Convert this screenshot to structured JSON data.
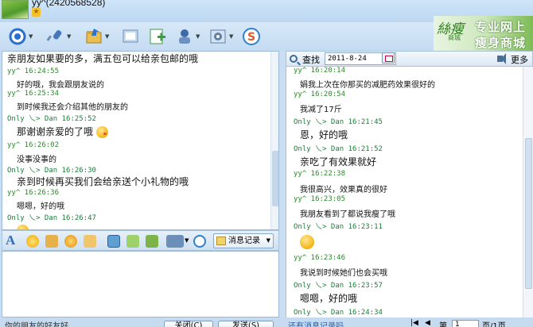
{
  "window": {
    "title": "yy^(2420568528)"
  },
  "toolbar": {
    "buttons": [
      {
        "name": "video-call-icon",
        "color": "#2b6fcf"
      },
      {
        "name": "voice-mic-icon",
        "color": "#4677b8"
      },
      {
        "name": "send-file-icon",
        "color": "#d2a23a"
      },
      {
        "name": "screenshot-icon",
        "color": "#6b8fb8"
      },
      {
        "name": "add-app-icon",
        "color": "#3c9b3c"
      },
      {
        "name": "remote-assist-icon",
        "color": "#3f6aa8"
      },
      {
        "name": "settings-icon",
        "color": "#5f7fa6"
      },
      {
        "name": "s-app-icon",
        "color": "#e2572b"
      }
    ]
  },
  "banner": {
    "logo": "絲瘦",
    "logo_sub": "商城",
    "line1": "专业网上",
    "line2": "瘦身商城"
  },
  "left_chat": {
    "messages": [
      {
        "kind": "text-big",
        "text": "亲朋友如果要的多，满五包可以给亲包邮的哦"
      },
      {
        "kind": "header",
        "text": "yy^  16:24:55"
      },
      {
        "kind": "text-sm",
        "text": "好的哦，我会跟朋友说的"
      },
      {
        "kind": "header",
        "text": "yy^  16:25:34"
      },
      {
        "kind": "text-sm",
        "text": "到时候我还会介绍其他的朋友的"
      },
      {
        "kind": "header-self",
        "text": "Only 乀> Dan  16:25:52"
      },
      {
        "kind": "text-big-emoji",
        "text": "那谢谢亲爱的了哦"
      },
      {
        "kind": "header",
        "text": "yy^  16:26:02"
      },
      {
        "kind": "text-sm",
        "text": "没事没事的"
      },
      {
        "kind": "header-self",
        "text": "Only 乀> Dan  16:26:30"
      },
      {
        "kind": "text-big",
        "text": "亲到时候再买我们会给亲送个小礼物的哦"
      },
      {
        "kind": "header",
        "text": "yy^  16:26:36"
      },
      {
        "kind": "text-sm",
        "text": "嗯嗯，好的哦"
      },
      {
        "kind": "header-self",
        "text": "Only 乀> Dan  16:26:47"
      }
    ]
  },
  "format_bar": {
    "font_label": "A",
    "icons": [
      "emoji-icon",
      "gift-icon",
      "shake-icon",
      "scribble-icon",
      "image-icon",
      "music-icon",
      "magic-face-icon",
      "screenshot-icon",
      "s-app-icon"
    ],
    "message_log_label": "消息记录"
  },
  "bottom": {
    "hint": "你的朋友的好友好",
    "close_label": "关闭(C)",
    "send_label": "发送(S)"
  },
  "right_head": {
    "find_label": "查找",
    "date_value": "2011-8-24",
    "more_label": "更多"
  },
  "right_chat": {
    "messages": [
      {
        "kind": "header",
        "text": "yy^  16:20:14"
      },
      {
        "kind": "text-sm",
        "text": "娟我上次在你那买的减肥药效果很好的"
      },
      {
        "kind": "header",
        "text": "yy^  16:20:54"
      },
      {
        "kind": "text-sm",
        "text": "我减了17斤"
      },
      {
        "kind": "header-self",
        "text": "Only 乀> Dan  16:21:45"
      },
      {
        "kind": "text-big",
        "text": "恩，好的哦"
      },
      {
        "kind": "header-self",
        "text": "Only 乀> Dan  16:21:52"
      },
      {
        "kind": "text-big",
        "text": "亲吃了有效果就好"
      },
      {
        "kind": "header",
        "text": "yy^  16:22:38"
      },
      {
        "kind": "text-sm",
        "text": "我很高兴，效果真的很好"
      },
      {
        "kind": "header",
        "text": "yy^  16:23:05"
      },
      {
        "kind": "text-sm",
        "text": "我朋友看到了都说我瘦了哦"
      },
      {
        "kind": "header-self",
        "text": "Only 乀> Dan  16:23:11"
      },
      {
        "kind": "emoji",
        "text": ""
      },
      {
        "kind": "header",
        "text": "yy^  16:23:46"
      },
      {
        "kind": "text-sm",
        "text": "我说到时候她们也会买哦"
      },
      {
        "kind": "header-self",
        "text": "Only 乀> Dan  16:23:57"
      },
      {
        "kind": "text-big",
        "text": "嗯嗯，好的哦"
      },
      {
        "kind": "header-self",
        "text": "Only 乀> Dan  16:24:34"
      }
    ]
  },
  "pager": {
    "link_label": "还有消息记录吗",
    "page_prefix": "第",
    "page_value": "1",
    "page_suffix": "页/1页"
  }
}
